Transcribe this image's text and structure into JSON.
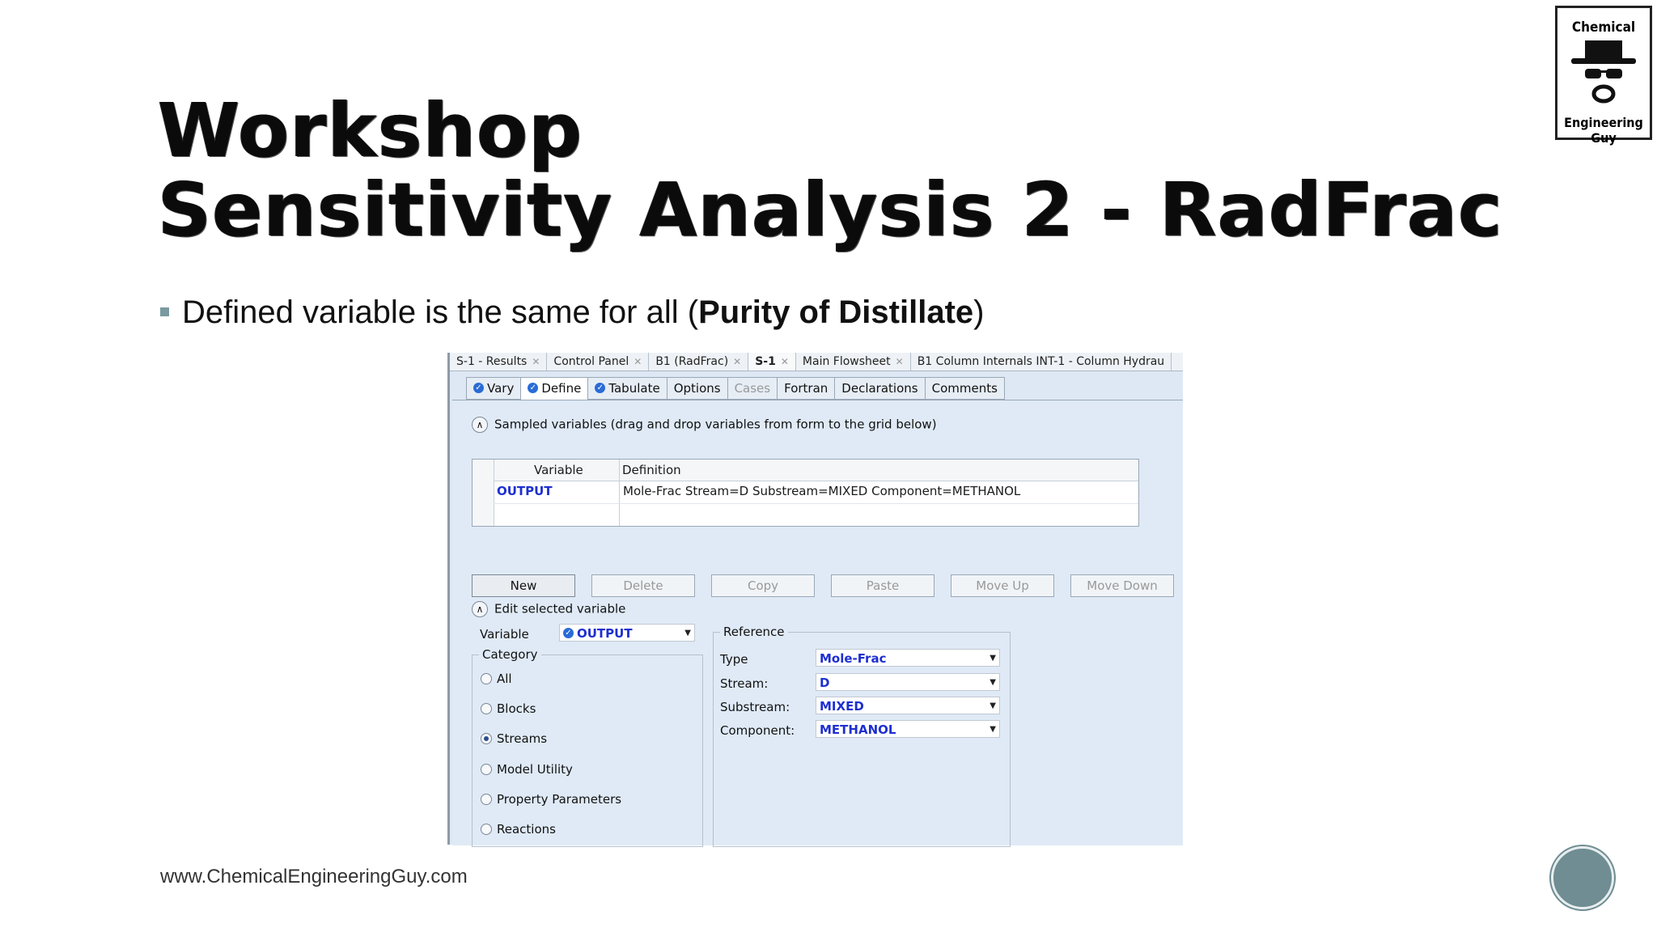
{
  "slide": {
    "title_line1": "Workshop",
    "title_line2": "Sensitivity Analysis 2 - RadFrac",
    "bullet_prefix": "Defined variable is the same for all (",
    "bullet_bold": "Purity of Distillate",
    "bullet_suffix": ")",
    "footer": "www.ChemicalEngineeringGuy.com",
    "logo_top": "Chemical",
    "logo_bottom": "Engineering Guy"
  },
  "doc_tabs": [
    {
      "label": "S-1 - Results"
    },
    {
      "label": "Control Panel"
    },
    {
      "label": "B1 (RadFrac)"
    },
    {
      "label": "S-1"
    },
    {
      "label": "Main Flowsheet"
    },
    {
      "label": "B1 Column Internals INT-1 - Column Hydrau"
    }
  ],
  "form_tabs": [
    {
      "label": "Vary"
    },
    {
      "label": "Define"
    },
    {
      "label": "Tabulate"
    },
    {
      "label": "Options"
    },
    {
      "label": "Cases"
    },
    {
      "label": "Fortran"
    },
    {
      "label": "Declarations"
    },
    {
      "label": "Comments"
    }
  ],
  "sampled": {
    "header": "Sampled variables (drag and drop variables from form to the grid below)",
    "col_variable": "Variable",
    "col_definition": "Definition",
    "row_variable": "OUTPUT",
    "row_definition": "Mole-Frac Stream=D Substream=MIXED Component=METHANOL"
  },
  "buttons": {
    "new": "New",
    "delete": "Delete",
    "copy": "Copy",
    "paste": "Paste",
    "move_up": "Move Up",
    "move_down": "Move Down"
  },
  "edit": {
    "header": "Edit selected variable",
    "variable_label": "Variable",
    "variable_value": "OUTPUT",
    "category_label": "Category",
    "categories": [
      "All",
      "Blocks",
      "Streams",
      "Model Utility",
      "Property Parameters",
      "Reactions"
    ],
    "selected_category": "Streams",
    "reference_label": "Reference",
    "type_label": "Type",
    "type_value": "Mole-Frac",
    "stream_label": "Stream:",
    "stream_value": "D",
    "substream_label": "Substream:",
    "substream_value": "MIXED",
    "component_label": "Component:",
    "component_value": "METHANOL"
  },
  "colors": {
    "accent": "#7a9aa0",
    "value_blue": "#1e2fd0"
  }
}
